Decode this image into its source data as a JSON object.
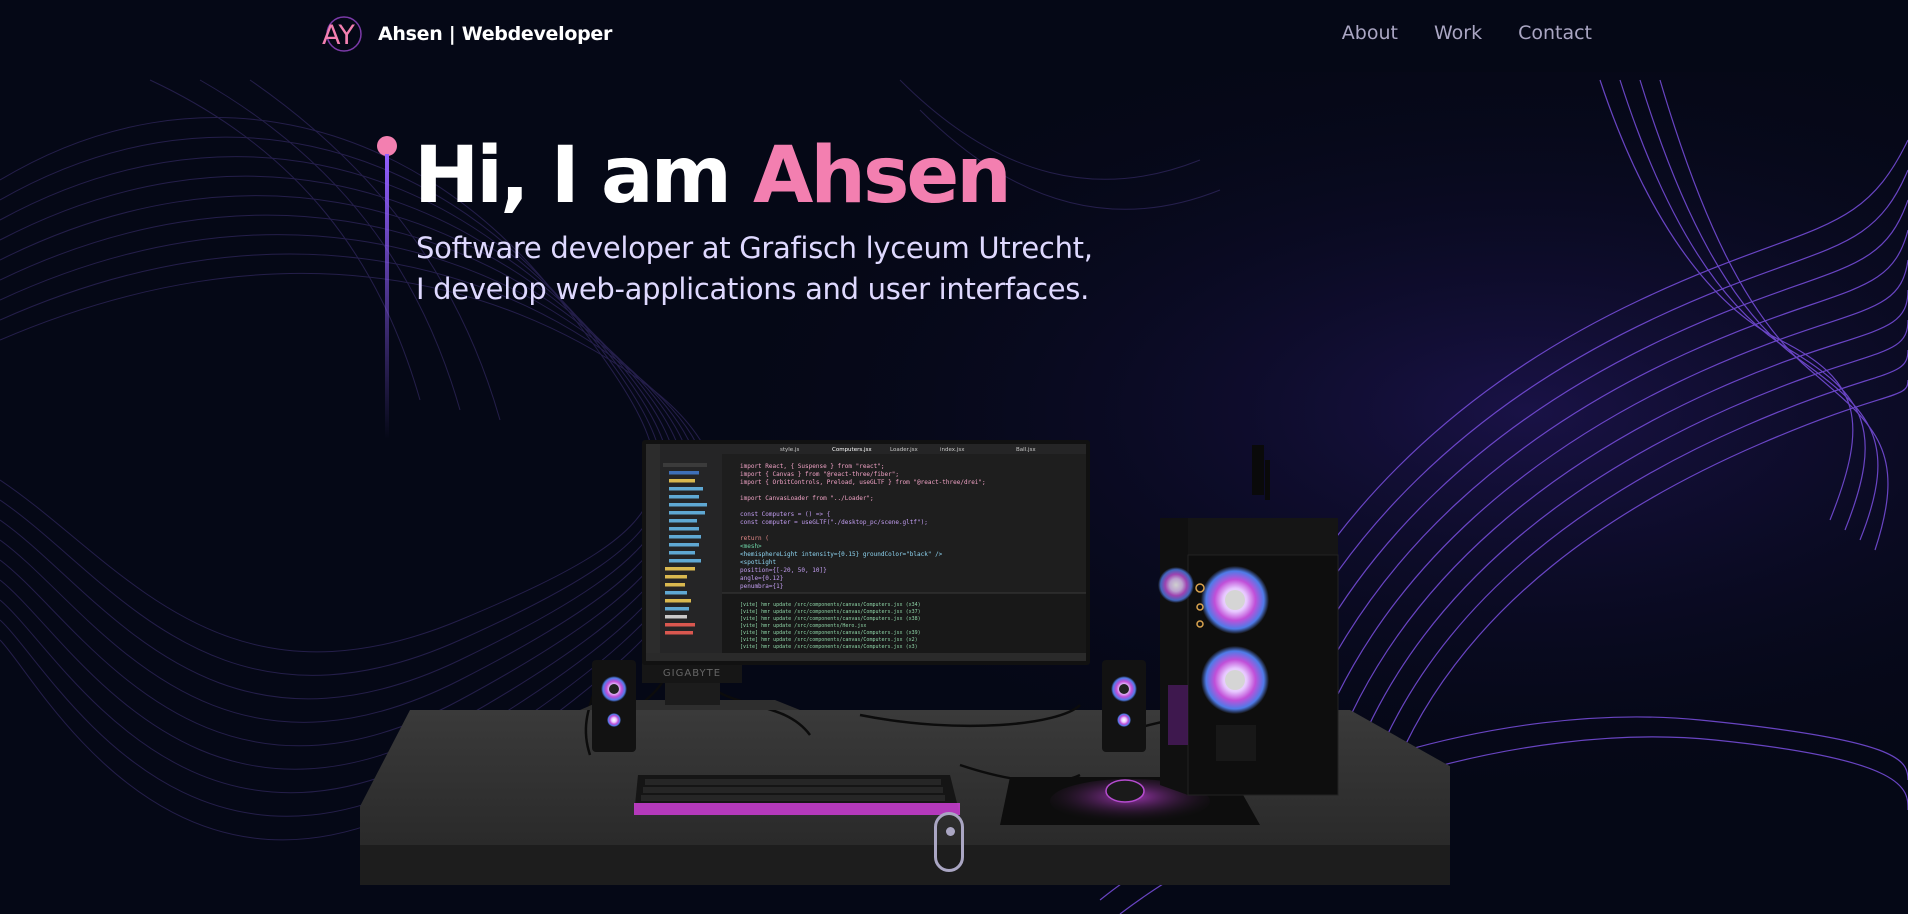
{
  "header": {
    "logo_text": "AY",
    "brand": "Ahsen | Webdeveloper",
    "nav": [
      {
        "label": "About"
      },
      {
        "label": "Work"
      },
      {
        "label": "Contact"
      }
    ]
  },
  "hero": {
    "greeting": "Hi, I am",
    "name": "Ahsen",
    "subtitle_line1": "Software developer at Grafisch lyceum Utrecht,",
    "subtitle_line2": "I develop web-applications and user interfaces."
  },
  "monitor": {
    "brand": "GIGABYTE",
    "tabs": [
      "style.js",
      "Computers.jsx",
      "Loader.jsx",
      "index.jsx",
      "Ball.jsx"
    ],
    "code": [
      "import React, { Suspense } from \"react\";",
      "import { Canvas } from \"@react-three/fiber\";",
      "import { OrbitControls, Preload, useGLTF } from \"@react-three/drei\";",
      "",
      "import CanvasLoader from \"../Loader\";",
      "",
      "const Computers = () => {",
      "  const computer = useGLTF(\"./desktop_pc/scene.gltf\");",
      "",
      "  return (",
      "    <mesh>",
      "      <hemisphereLight intensity={0.15} groundColor=\"black\" />",
      "      <spotLight",
      "        position={[-20, 50, 10]}",
      "        angle={0.12}",
      "        penumbra={1}"
    ],
    "terminal": [
      "[vite] hmr update /src/components/canvas/Computers.jsx (x34)",
      "[vite] hmr update /src/components/canvas/Computers.jsx (x37)",
      "[vite] hmr update /src/components/canvas/Computers.jsx (x38)",
      "[vite] hmr update /src/components/Hero.jsx",
      "[vite] hmr update /src/components/canvas/Computers.jsx (x39)",
      "[vite] hmr update /src/components/canvas/Computers.jsx (x2)",
      "[vite] hmr update /src/components/canvas/Computers.jsx (x3)"
    ]
  },
  "colors": {
    "background": "#050816",
    "accent_pink": "#f37fb0",
    "accent_purple": "#804dee",
    "text_secondary": "#aaa6c3"
  }
}
